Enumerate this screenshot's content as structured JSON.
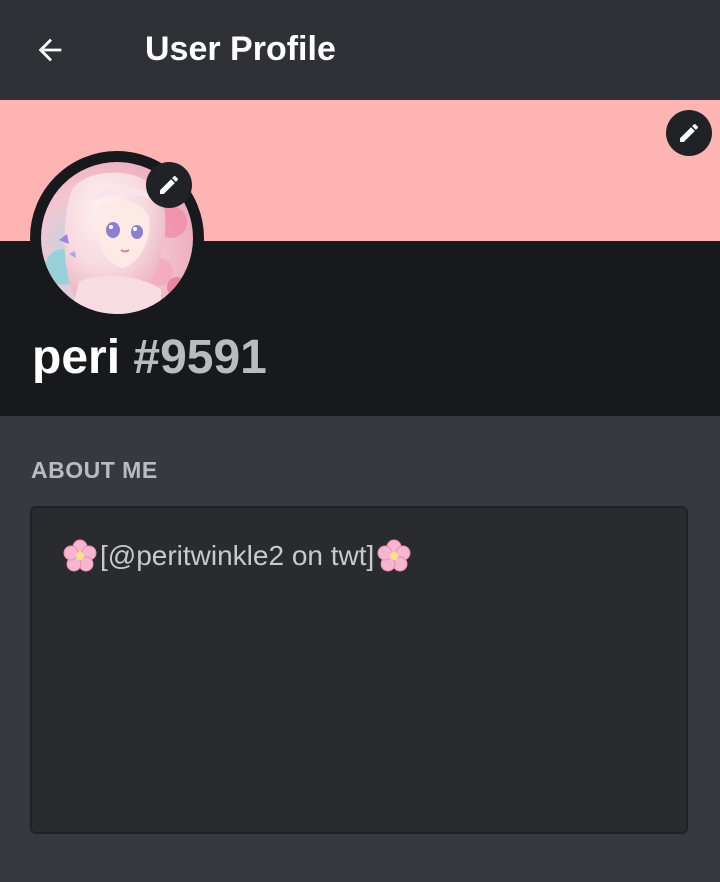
{
  "header": {
    "title": "User Profile",
    "back_icon": "arrow-left-icon"
  },
  "colors": {
    "header_bg": "#2f3136",
    "banner": "#ffb4b4",
    "profile_band_bg": "#18191c",
    "page_bg": "#36393f",
    "about_box_bg": "#292b2f"
  },
  "profile": {
    "username": "peri",
    "discriminator": "#9591",
    "banner_edit_icon": "pencil-icon",
    "avatar_edit_icon": "pencil-icon"
  },
  "about": {
    "label": "ABOUT ME",
    "prefix_emoji": "cherry-blossom-icon",
    "text": "[@peritwinkle2 on twt]",
    "suffix_emoji": "cherry-blossom-icon"
  }
}
